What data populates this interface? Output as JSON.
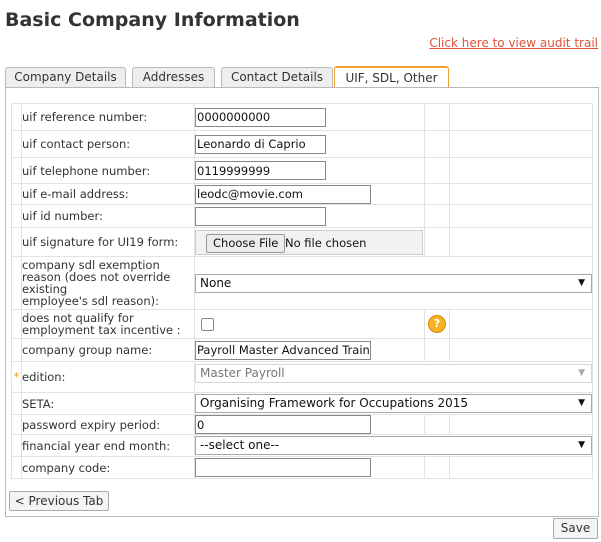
{
  "page": {
    "title": "Basic Company Information",
    "audit_link": "Click here to view audit trail"
  },
  "tabs": [
    {
      "label": "Company Details",
      "active": false
    },
    {
      "label": "Addresses",
      "active": false
    },
    {
      "label": "Contact Details",
      "active": false
    },
    {
      "label": "UIF, SDL, Other",
      "active": true
    }
  ],
  "form": {
    "uif_reference": {
      "label": "uif reference number:",
      "value": "0000000000"
    },
    "uif_contact": {
      "label": "uif contact person:",
      "value": "Leonardo di Caprio"
    },
    "uif_telephone": {
      "label": "uif telephone number:",
      "value": "0119999999"
    },
    "uif_email": {
      "label": "uif e-mail address:",
      "value": "leodc@movie.com"
    },
    "uif_id": {
      "label": "uif id number:",
      "value": ""
    },
    "uif_signature": {
      "label": "uif signature for UI19 form:",
      "button": "Choose File",
      "status": "No file chosen"
    },
    "sdl_exemption": {
      "label_lines": [
        "company sdl exemption",
        "reason (does not override",
        "existing",
        "employee's sdl reason):"
      ],
      "value": "None"
    },
    "tax_incentive": {
      "label_lines": [
        "does not qualify for",
        "employment tax incentive :"
      ],
      "checked": false,
      "help_icon": "question-mark-icon"
    },
    "group_name": {
      "label": "company group name:",
      "value": "Payroll Master Advanced Training"
    },
    "edition": {
      "required_mark": "*",
      "label": "edition:",
      "value": "Master Payroll",
      "disabled": true
    },
    "seta": {
      "label": "SETA:",
      "value": "Organising Framework for Occupations 2015"
    },
    "password_expiry": {
      "label": "password expiry period:",
      "value": "0"
    },
    "financial_year_end": {
      "label": "financial year end month:",
      "value": "--select one--"
    },
    "company_code": {
      "label": "company code:",
      "value": ""
    }
  },
  "buttons": {
    "previous_tab": "< Previous Tab",
    "save": "Save"
  },
  "colors": {
    "accent_orange": "#f0a030",
    "link": "#e0533a",
    "help_icon": "#f4b324"
  }
}
